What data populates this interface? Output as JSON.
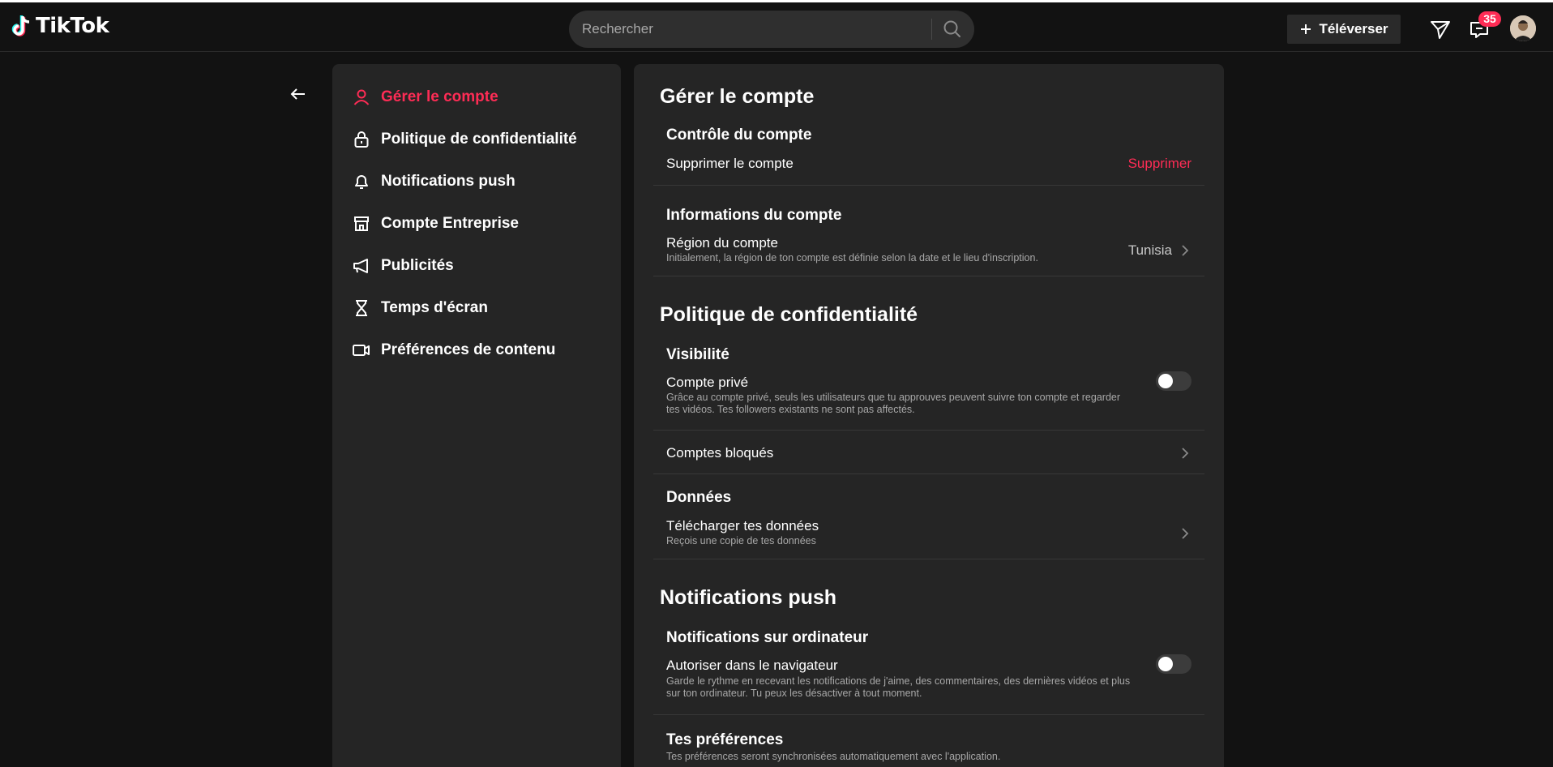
{
  "app": {
    "name": "TikTok",
    "brand_cyan": "#25f4ee",
    "brand_red": "#fe2c55"
  },
  "search": {
    "placeholder": "Rechercher"
  },
  "header": {
    "upload_label": "Téléverser",
    "notification_count": "35"
  },
  "sidebar": {
    "items": [
      {
        "label": "Gérer le compte",
        "icon": "user-icon",
        "active": true
      },
      {
        "label": "Politique de confidentialité",
        "icon": "lock-icon"
      },
      {
        "label": "Notifications push",
        "icon": "bell-icon"
      },
      {
        "label": "Compte Entreprise",
        "icon": "shop-icon"
      },
      {
        "label": "Publicités",
        "icon": "megaphone-icon"
      },
      {
        "label": "Temps d'écran",
        "icon": "hourglass-icon"
      },
      {
        "label": "Préférences de contenu",
        "icon": "video-camera-icon"
      }
    ]
  },
  "main": {
    "account": {
      "title": "Gérer le compte",
      "control": {
        "title": "Contrôle du compte",
        "delete_label": "Supprimer le compte",
        "delete_action": "Supprimer"
      },
      "info": {
        "title": "Informations du compte",
        "region_label": "Région du compte",
        "region_desc": "Initialement, la région de ton compte est définie selon la date et le lieu d'inscription.",
        "region_value": "Tunisia"
      }
    },
    "privacy": {
      "title": "Politique de confidentialité",
      "visibility": {
        "title": "Visibilité",
        "private_label": "Compte privé",
        "private_desc": "Grâce au compte privé, seuls les utilisateurs que tu approuves peuvent suivre ton compte et regarder tes vidéos. Tes followers existants ne sont pas affectés.",
        "private_enabled": false
      },
      "blocked_label": "Comptes bloqués",
      "data": {
        "title": "Données",
        "download_label": "Télécharger tes données",
        "download_desc": "Reçois une copie de tes données"
      }
    },
    "push": {
      "title": "Notifications push",
      "desktop": {
        "title": "Notifications sur ordinateur",
        "allow_label": "Autoriser dans le navigateur",
        "allow_desc": "Garde le rythme en recevant les notifications de j'aime, des commentaires, des dernières vidéos et plus sur ton ordinateur. Tu peux les désactiver à tout moment.",
        "allow_enabled": false
      },
      "prefs": {
        "title": "Tes préférences",
        "desc": "Tes préférences seront synchronisées automatiquement avec l'application."
      }
    }
  }
}
